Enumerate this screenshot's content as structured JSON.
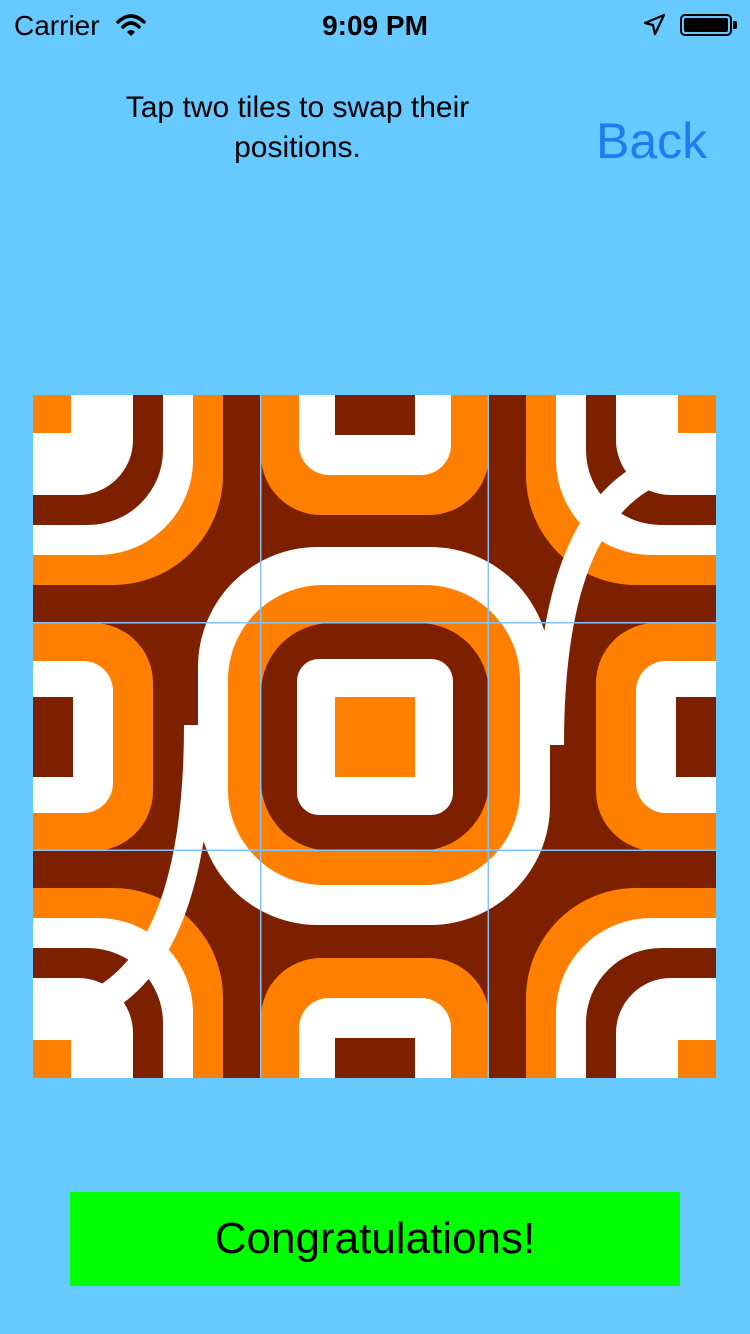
{
  "status_bar": {
    "carrier": "Carrier",
    "time": "9:09 PM",
    "wifi_icon": "wifi-icon",
    "location_icon": "location-arrow-icon",
    "battery_icon": "battery-icon"
  },
  "header": {
    "instructions": "Tap two tiles to swap their positions.",
    "back_label": "Back"
  },
  "puzzle": {
    "rows": 3,
    "cols": 3,
    "colors": {
      "background": "#66c9ff",
      "brown": "#7d2000",
      "orange": "#ff8000",
      "white": "#ffffff",
      "grid": "#7fc4ff"
    }
  },
  "footer": {
    "message": "Congratulations!",
    "message_bg": "#00ff00"
  },
  "colors": {
    "back_link": "#1d7cf2"
  }
}
